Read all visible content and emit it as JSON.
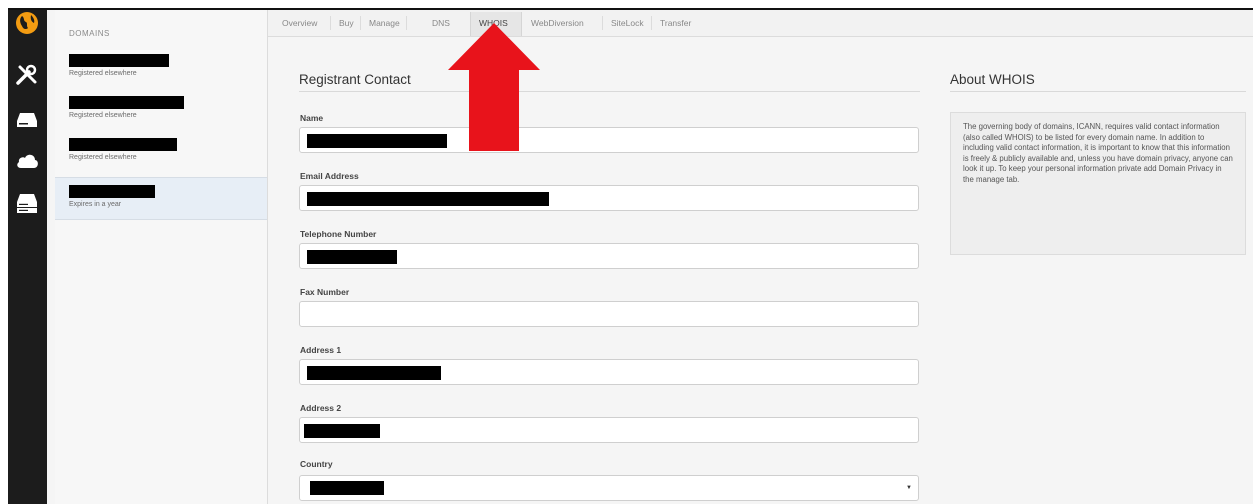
{
  "sidebar": {
    "icons": [
      "globe-icon",
      "tools-icon",
      "drive-icon",
      "cloud-icon",
      "server-icon"
    ]
  },
  "domains": {
    "header": "DOMAINS",
    "items": [
      {
        "status": "Registered elsewhere",
        "selected": false
      },
      {
        "status": "Registered elsewhere",
        "selected": false
      },
      {
        "status": "Registered elsewhere",
        "selected": false
      },
      {
        "status": "Expires in a year",
        "selected": true
      }
    ]
  },
  "tabs": [
    "Overview",
    "Buy",
    "Manage",
    "DNS",
    "WHOIS",
    "WebDiversion",
    "SiteLock",
    "Transfer"
  ],
  "active_tab": "WHOIS",
  "form": {
    "title": "Registrant Contact",
    "fields": [
      {
        "label": "Name",
        "value_redacted": true
      },
      {
        "label": "Email Address",
        "value_redacted": true
      },
      {
        "label": "Telephone Number",
        "value_redacted": true
      },
      {
        "label": "Fax Number",
        "value": ""
      },
      {
        "label": "Address 1",
        "value_redacted": true
      },
      {
        "label": "Address 2",
        "value_redacted": true
      },
      {
        "label": "Country",
        "value_redacted": true,
        "type": "select"
      }
    ]
  },
  "about": {
    "title": "About WHOIS",
    "text": "The governing body of domains, ICANN, requires valid contact information (also called WHOIS) to be listed for every domain name. In addition to including valid contact information, it is important to know that this information is freely & publicly available and, unless you have domain privacy, anyone can look it up. To keep your personal information private add Domain Privacy in the manage tab."
  },
  "colors": {
    "rail": "#1c1c1c",
    "globe_accent": "#f39c12",
    "annotation_arrow": "#e8131b"
  }
}
